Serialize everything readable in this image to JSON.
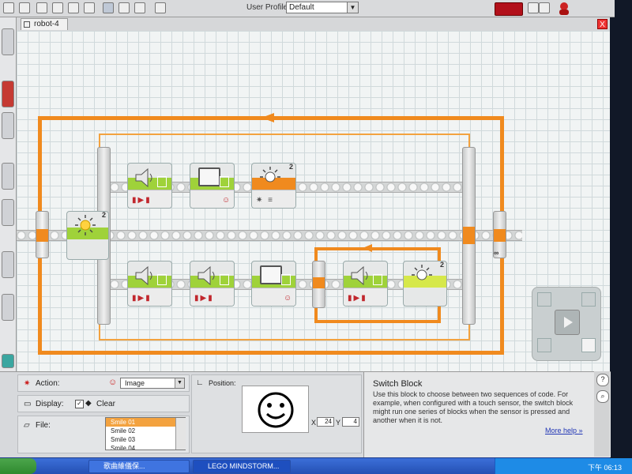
{
  "toolbar": {
    "user_profile_label": "User Profile:",
    "user_profile_value": "Default"
  },
  "tab": {
    "label": "robot-4",
    "close": "X"
  },
  "program": {
    "outer_switch_number": "2",
    "top_light_number": "2",
    "inner_switch_number": "2"
  },
  "config": {
    "action_label": "Action:",
    "action_value": "Image",
    "display_label": "Display:",
    "clear_label": "Clear",
    "file_label": "File:",
    "files": [
      "Smile 01",
      "Smile 02",
      "Smile 03",
      "Smile 04"
    ],
    "position_label": "Position:",
    "x_label": "X",
    "x_value": "24",
    "y_label": "Y",
    "y_value": "4"
  },
  "help": {
    "title": "Switch Block",
    "body": "Use this block to choose between two sequences of code. For example, when configured with a touch sensor, the switch block might run one series of blocks when the sensor is pressed and another when it is not.",
    "more_help": "More help »"
  },
  "taskbar": {
    "buttons": [
      "歌曲維儀保...",
      "LEGO MINDSTORM..."
    ],
    "clock": "下午 06:13"
  },
  "colors": {
    "loop_orange": "#f08a1e",
    "action_green": "#9fd23a",
    "taskbar_blue": "#2450b3"
  }
}
